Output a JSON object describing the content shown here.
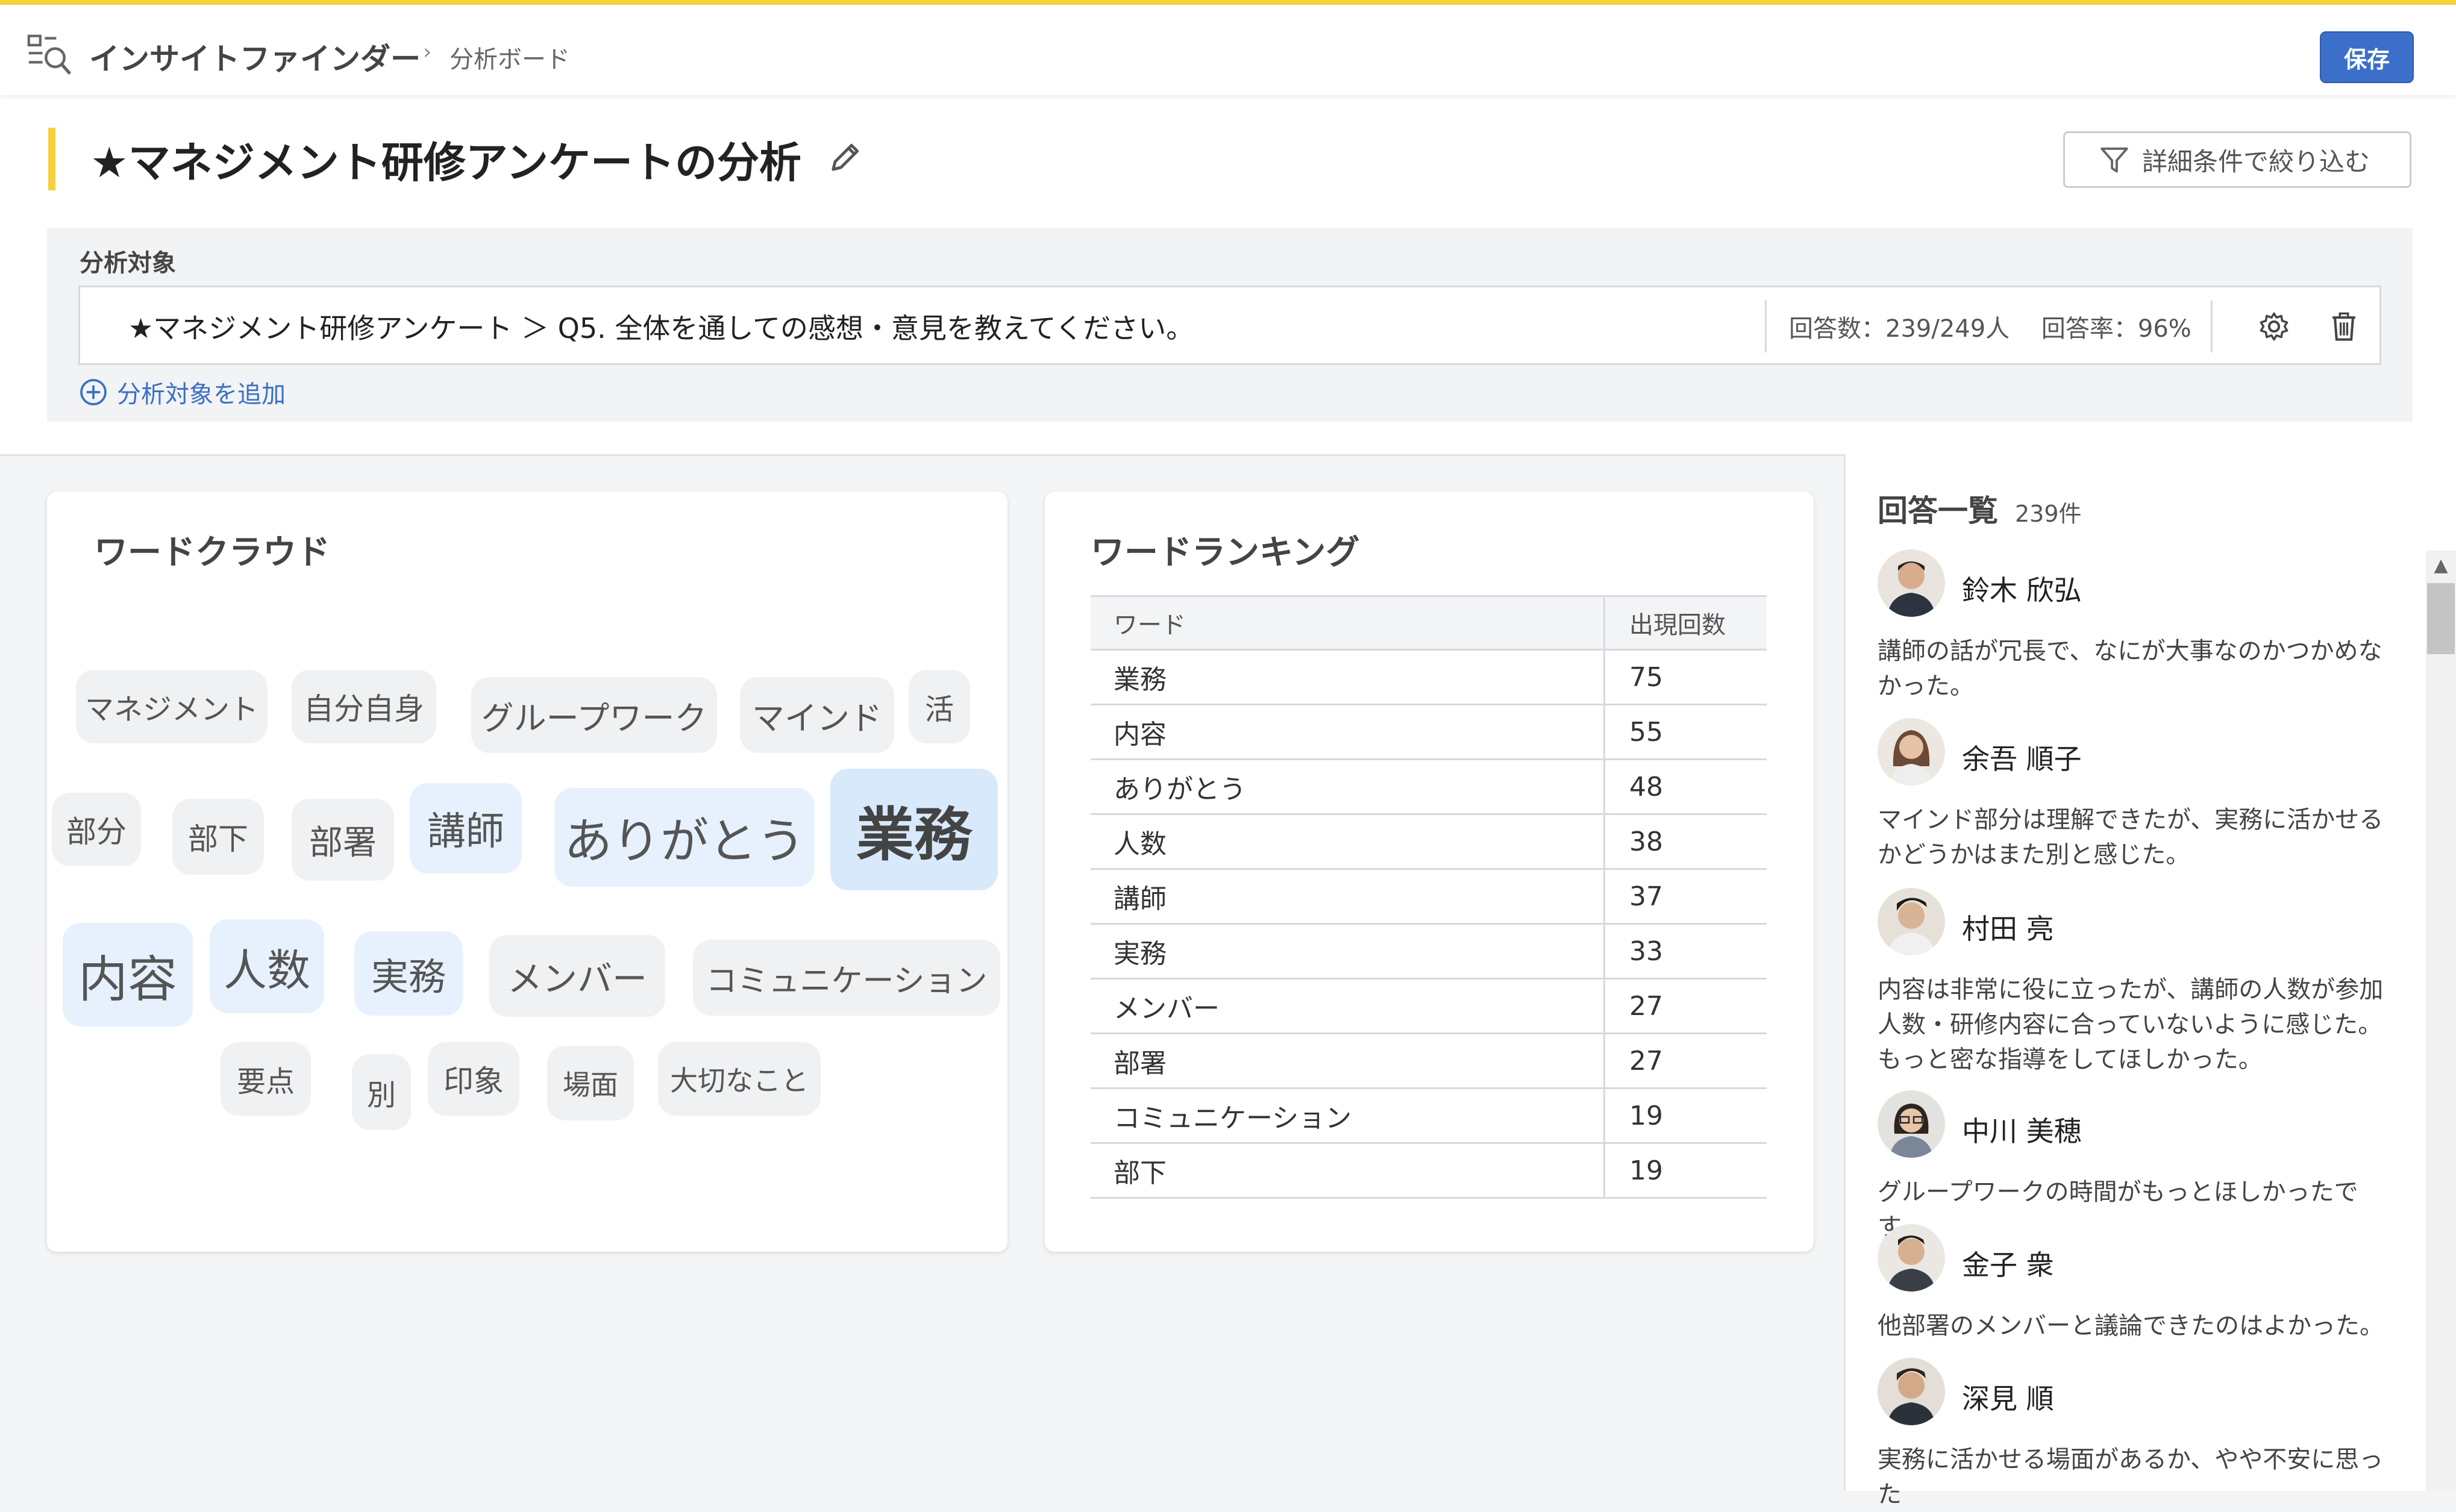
{
  "header": {
    "app_name": "インサイトファインダー",
    "breadcrumb_separator": "›",
    "breadcrumb": "分析ボード",
    "save_label": "保存",
    "app_icon": "search-list-icon"
  },
  "page": {
    "title": "★マネジメント研修アンケートの分析",
    "filter_label": "詳細条件で絞り込む"
  },
  "analysis_target": {
    "section_label": "分析対象",
    "text": "★マネジメント研修アンケート ＞ Q5. 全体を通しての感想・意見を教えてください。",
    "stats": "回答数：239/249人　 回答率：96%",
    "add_label": "分析対象を追加"
  },
  "word_cloud": {
    "title": "ワードクラウド",
    "words": [
      "マネジメント",
      "自分自身",
      "グループワーク",
      "マインド",
      "活",
      "部分",
      "部下",
      "部署",
      "講師",
      "ありがとう",
      "業務",
      "内容",
      "人数",
      "実務",
      "メンバー",
      "コミュニケーション",
      "要点",
      "別",
      "印象",
      "場面",
      "大切なこと"
    ]
  },
  "word_ranking": {
    "title": "ワードランキング",
    "col_word": "ワード",
    "col_count": "出現回数",
    "rows": [
      {
        "word": "業務",
        "count": "75"
      },
      {
        "word": "内容",
        "count": "55"
      },
      {
        "word": "ありがとう",
        "count": "48"
      },
      {
        "word": "人数",
        "count": "38"
      },
      {
        "word": "講師",
        "count": "37"
      },
      {
        "word": "実務",
        "count": "33"
      },
      {
        "word": "メンバー",
        "count": "27"
      },
      {
        "word": "部署",
        "count": "27"
      },
      {
        "word": "コミュニケーション",
        "count": "19"
      },
      {
        "word": "部下",
        "count": "19"
      }
    ]
  },
  "responses": {
    "title": "回答一覧",
    "count": "239件",
    "items": [
      {
        "name": "鈴木 欣弘",
        "text": "講師の話が冗長で、なにが大事なのかつかめなかった。"
      },
      {
        "name": "余吾 順子",
        "text": "マインド部分は理解できたが、実務に活かせるかどうかはまた別と感じた。"
      },
      {
        "name": "村田 亮",
        "text": "内容は非常に役に立ったが、講師の人数が参加人数・研修内容に合っていないように感じた。もっと密な指導をしてほしかった。"
      },
      {
        "name": "中川 美穂",
        "text": "グループワークの時間がもっとほしかったです。"
      },
      {
        "name": "金子 衆",
        "text": "他部署のメンバーと議論できたのはよかった。"
      },
      {
        "name": "深見 順",
        "text": "実務に活かせる場面があるか、やや不安に思った"
      }
    ]
  },
  "colors": {
    "accent_yellow": "#f5cf3c",
    "primary_blue": "#3b6fc9",
    "highlight_blue": "#e6f1fd"
  }
}
